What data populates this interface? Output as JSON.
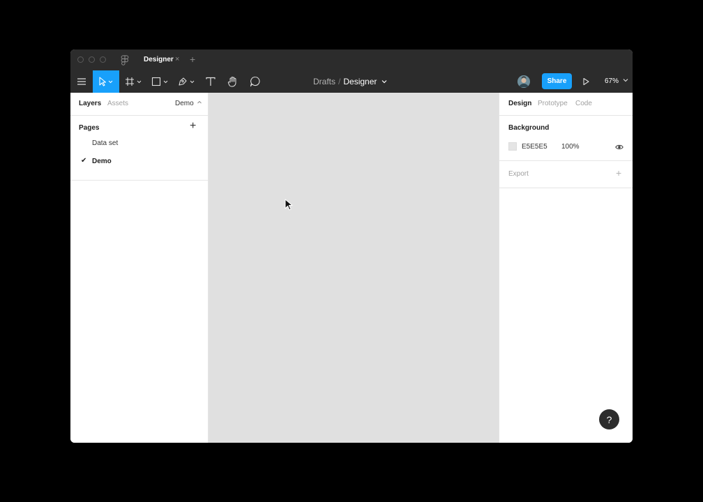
{
  "titlebar": {
    "tab_label": "Designer",
    "tab_close": "×",
    "tab_add": "+"
  },
  "toolbar": {
    "breadcrumb_team": "Drafts",
    "breadcrumb_sep": "/",
    "breadcrumb_file": "Designer",
    "share_label": "Share",
    "zoom_label": "67%",
    "accent": "#18a0fb"
  },
  "left_panel": {
    "tabs": [
      {
        "label": "Layers",
        "active": true
      },
      {
        "label": "Assets",
        "active": false
      }
    ],
    "page_select": "Demo",
    "pages_title": "Pages",
    "add_icon": "+",
    "pages": [
      {
        "label": "Data set",
        "active": false
      },
      {
        "label": "Demo",
        "active": true
      }
    ],
    "check": "✔"
  },
  "right_panel": {
    "tabs": [
      {
        "label": "Design",
        "active": true
      },
      {
        "label": "Prototype",
        "active": false
      },
      {
        "label": "Code",
        "active": false
      }
    ],
    "background_title": "Background",
    "background_hex": "E5E5E5",
    "background_opacity": "100%",
    "export_title": "Export",
    "export_add": "+"
  },
  "canvas": {
    "color": "#e0e0e0"
  },
  "help": {
    "label": "?"
  }
}
